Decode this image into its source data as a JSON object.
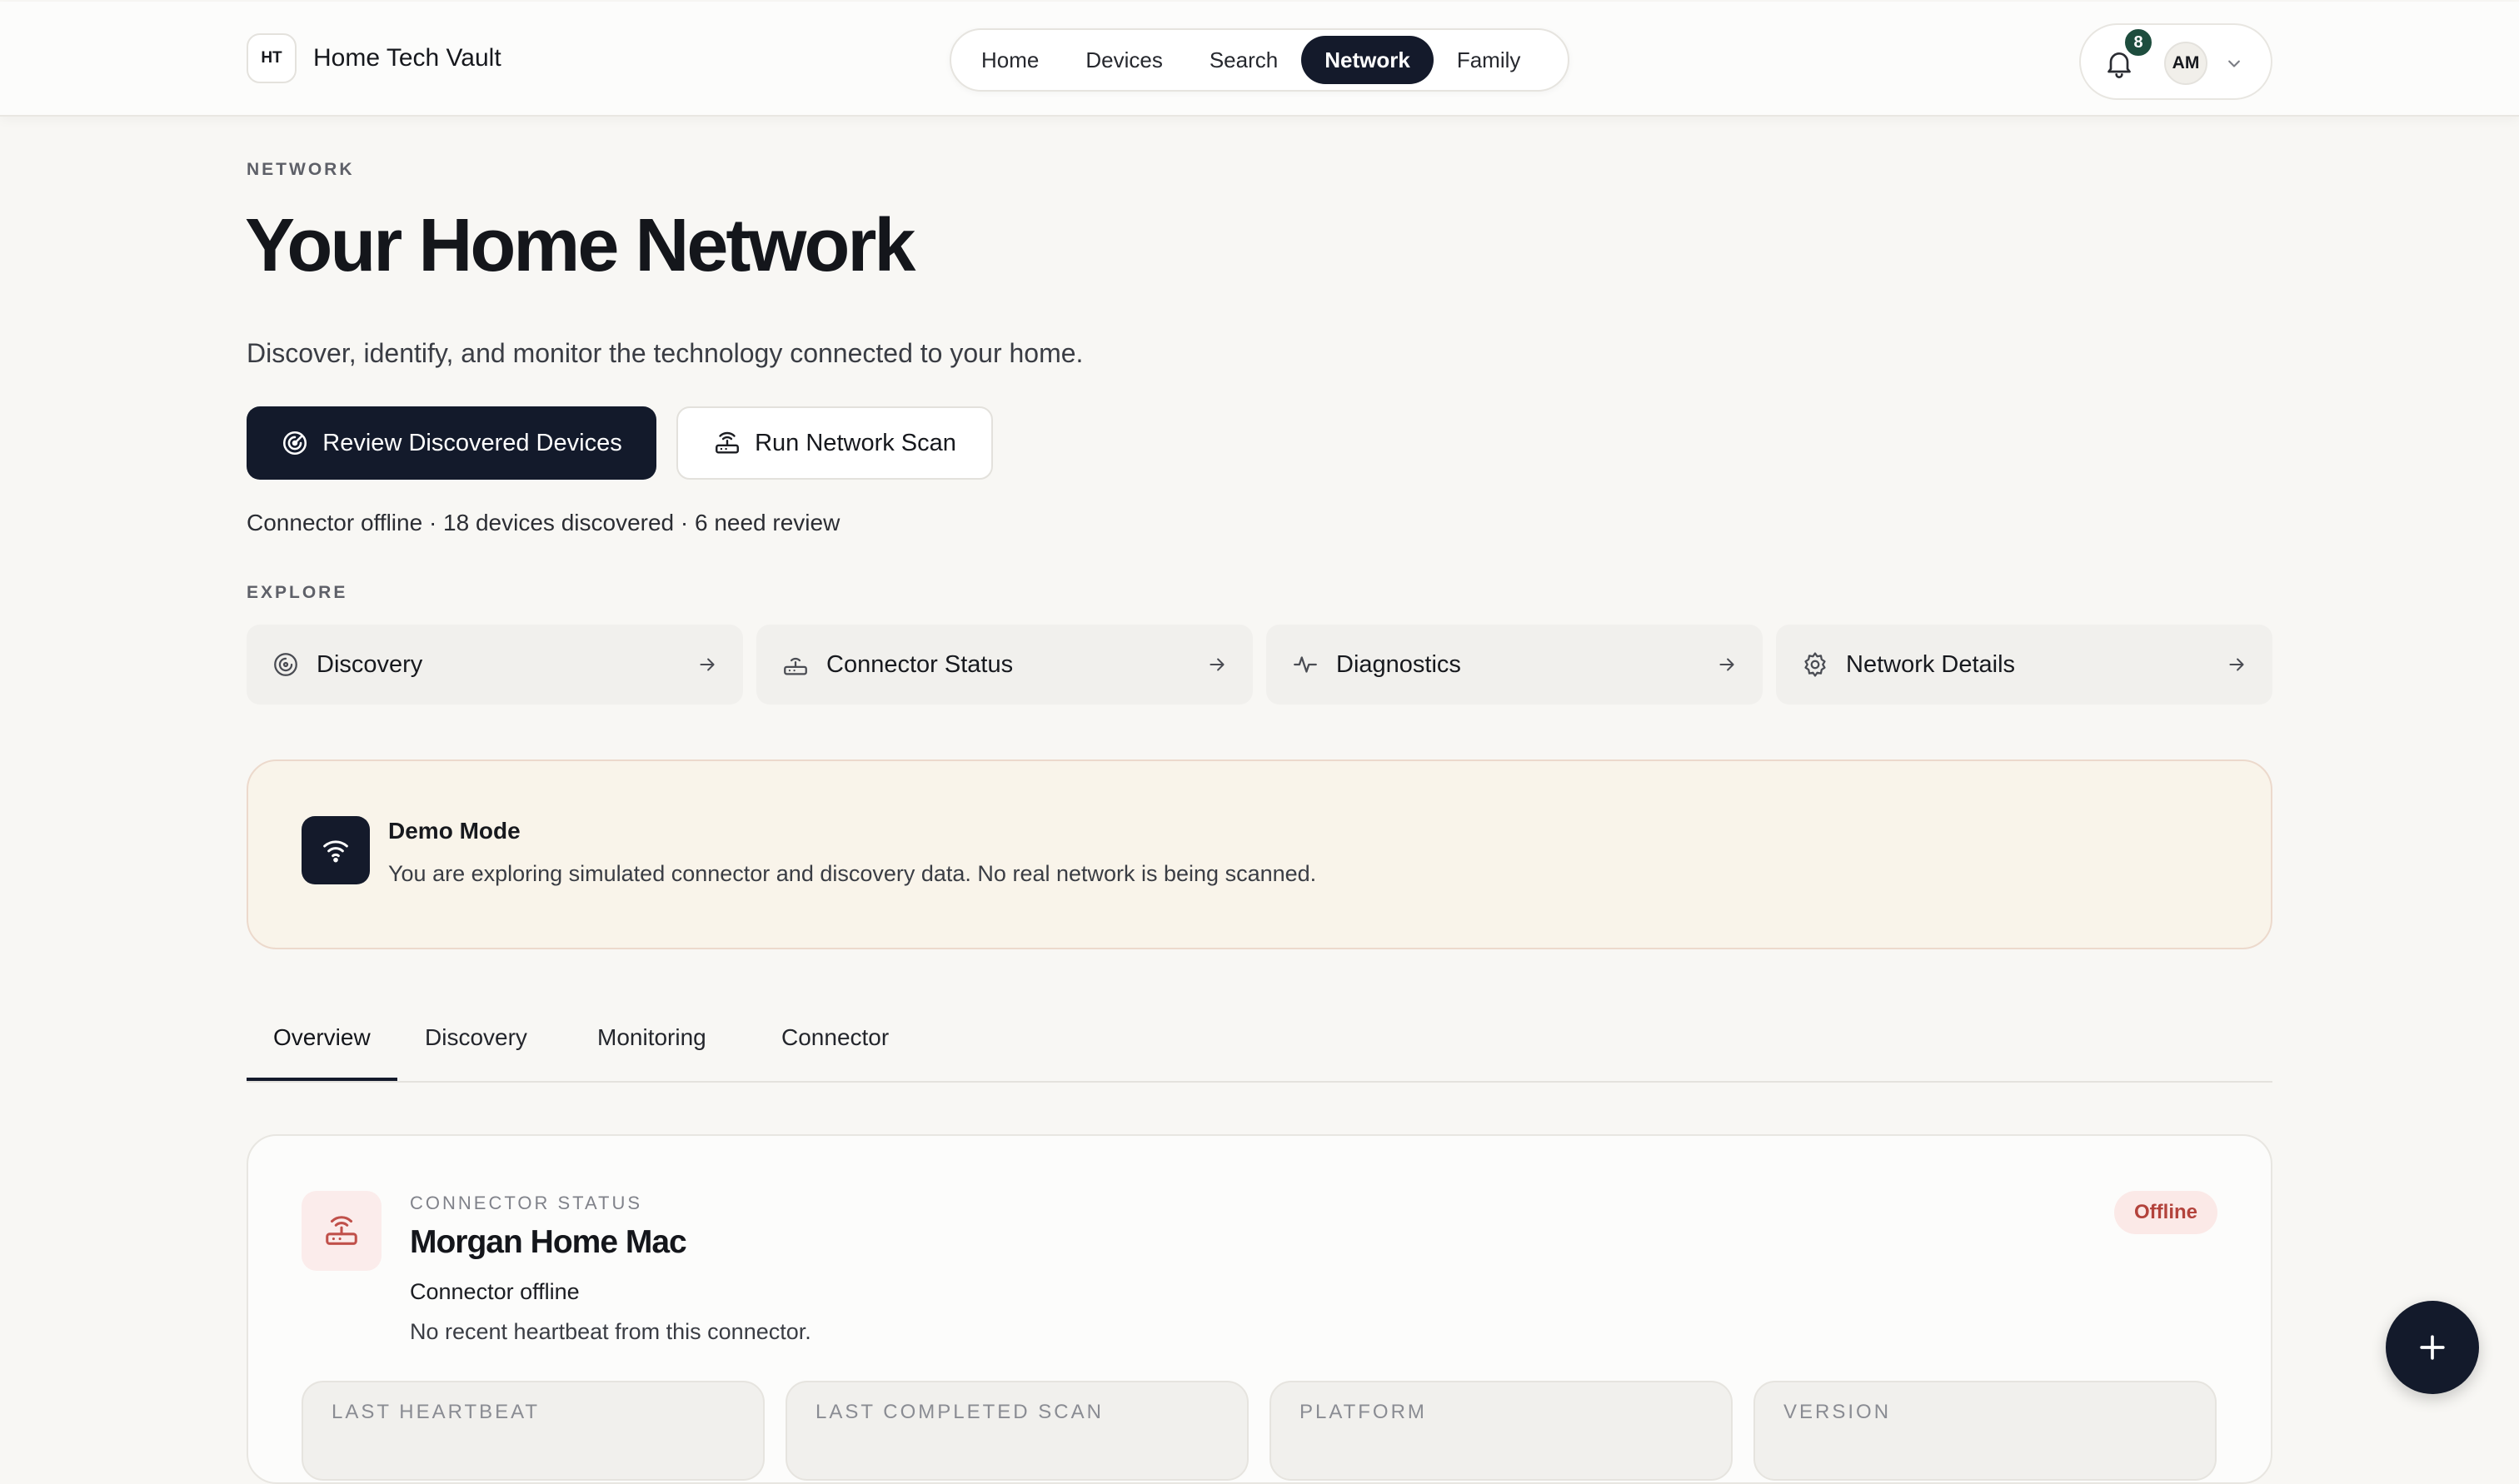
{
  "brand": {
    "mark": "HT",
    "name": "Home Tech Vault"
  },
  "nav": {
    "items": [
      "Home",
      "Devices",
      "Search",
      "Network",
      "Family"
    ],
    "active": "Network"
  },
  "account": {
    "notifications_count": "8",
    "avatar_initials": "AM"
  },
  "page": {
    "eyebrow": "NETWORK",
    "title": "Your Home Network",
    "subtitle": "Discover, identify, and monitor the technology connected to your home.",
    "primary_action": "Review Discovered Devices",
    "secondary_action": "Run Network Scan",
    "status_line": "Connector offline · 18 devices discovered · 6 need review"
  },
  "explore": {
    "heading": "EXPLORE",
    "cards": [
      "Discovery",
      "Connector Status",
      "Diagnostics",
      "Network Details"
    ]
  },
  "demo": {
    "title": "Demo Mode",
    "text": "You are exploring simulated connector and discovery data. No real network is being scanned."
  },
  "tabs": {
    "items": [
      "Overview",
      "Discovery",
      "Monitoring",
      "Connector"
    ],
    "active": "Overview"
  },
  "connector": {
    "eyebrow": "CONNECTOR STATUS",
    "name": "Morgan Home Mac",
    "state": "Connector offline",
    "note": "No recent heartbeat from this connector.",
    "badge": "Offline",
    "metrics": [
      "LAST HEARTBEAT",
      "LAST COMPLETED SCAN",
      "PLATFORM",
      "VERSION"
    ]
  },
  "colors": {
    "primary": "#131a2b",
    "badge_green": "#1e4d3e",
    "offline_text": "#b3433c",
    "demo_bg": "#f9f4ea"
  }
}
